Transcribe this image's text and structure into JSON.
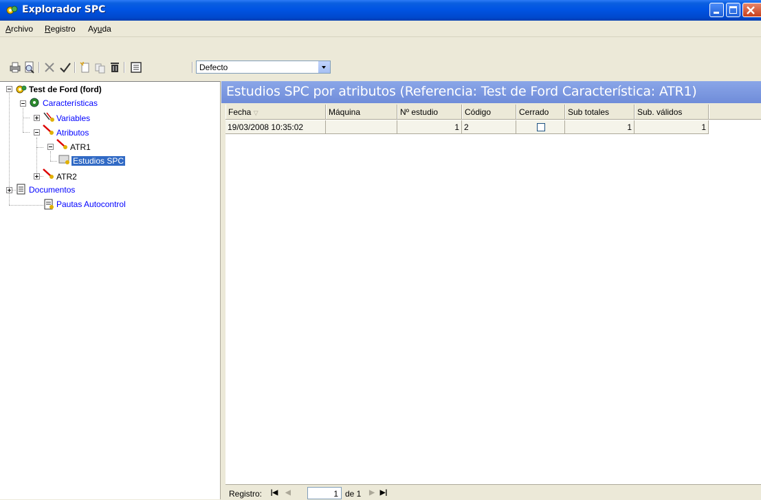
{
  "window": {
    "title": "Explorador SPC"
  },
  "menu": [
    {
      "label": "Archivo",
      "mnemonic": "A",
      "rest": "rchivo"
    },
    {
      "label": "Registro",
      "mnemonic": "R",
      "rest": "egistro"
    },
    {
      "label": "Ayuda",
      "pre": "Ay",
      "mnemonic": "u",
      "rest": "da"
    }
  ],
  "toolbar": {
    "icons": [
      "print-icon",
      "print-preview-icon",
      "delete-icon",
      "accept-icon",
      "new-icon",
      "copy-icon",
      "trash-icon",
      "form-icon"
    ],
    "view_combo": "Defecto"
  },
  "tree": {
    "root": "Test de Ford (ford)",
    "caracteristicas": "Características",
    "variables": "Variables",
    "atributos": "Atributos",
    "atr1": "ATR1",
    "estudios": "Estudios SPC",
    "atr2": "ATR2",
    "documentos": "Documentos",
    "pautas": "Pautas Autocontrol"
  },
  "panel": {
    "title": "Estudios SPC por atributos (Referencia: Test de Ford Característica: ATR1)"
  },
  "grid": {
    "columns": [
      "Fecha",
      "Máquina",
      "Nº estudio",
      "Código",
      "Cerrado",
      "Sub totales",
      "Sub. válidos"
    ],
    "rows": [
      {
        "fecha": "19/03/2008 10:35:02",
        "maquina": "",
        "n_estudio": "1",
        "codigo": "2",
        "cerrado": false,
        "sub_totales": "1",
        "sub_validos": "1"
      }
    ]
  },
  "navigator": {
    "label": "Registro:",
    "current": "1",
    "of_text": "de 1"
  }
}
